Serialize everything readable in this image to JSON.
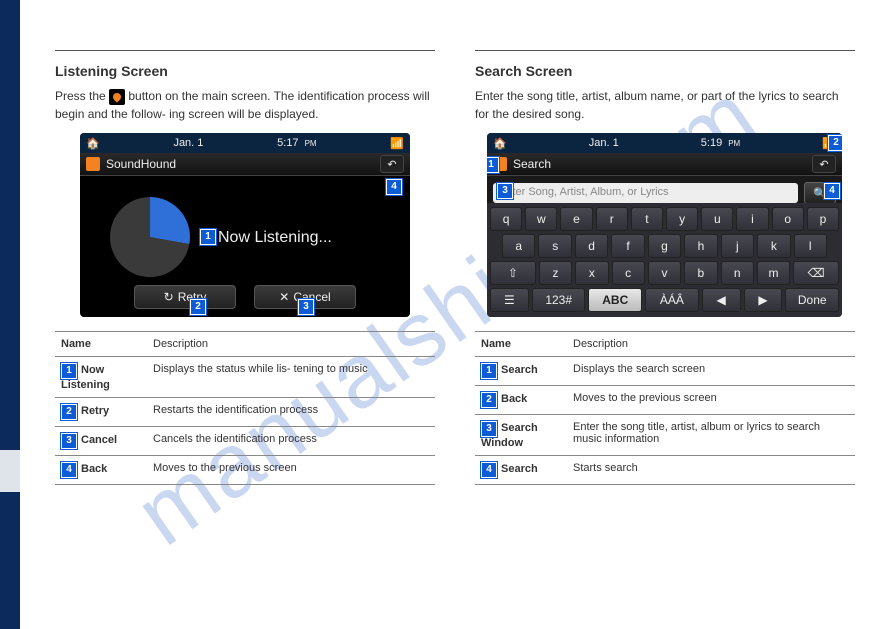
{
  "watermark": "manualshive.com",
  "sidebar": {},
  "left": {
    "title": "Listening Screen",
    "intro_before": "Press the ",
    "intro_after": " button on the main screen. The identification process will begin and the follow- ing screen will be displayed.",
    "shot": {
      "status_date": "Jan.   1",
      "status_time": "5:17",
      "status_ampm": "PM",
      "app_name": "SoundHound",
      "now_listening": "Now Listening...",
      "retry": "Retry",
      "cancel": "Cancel"
    },
    "table_header_name": "Name",
    "table_header_desc": "Description",
    "rows": [
      {
        "n": "1",
        "name": "Now Listening",
        "desc": "Displays the status while lis- tening to music"
      },
      {
        "n": "2",
        "name": "Retry",
        "desc": "Restarts the identification process"
      },
      {
        "n": "3",
        "name": "Cancel",
        "desc": "Cancels the identification process"
      },
      {
        "n": "4",
        "name": "Back",
        "desc": "Moves to the previous screen"
      }
    ]
  },
  "right": {
    "title": "Search Screen",
    "intro": "Enter the song title, artist, album name, or part of the lyrics to search for the desired song.",
    "shot": {
      "status_date": "Jan.   1",
      "status_time": "5:19",
      "status_ampm": "PM",
      "app_name": "Search",
      "placeholder": "Enter Song, Artist, Album, or Lyrics",
      "keys_row1": [
        "q",
        "w",
        "e",
        "r",
        "t",
        "y",
        "u",
        "i",
        "o",
        "p"
      ],
      "keys_row2": [
        "a",
        "s",
        "d",
        "f",
        "g",
        "h",
        "j",
        "k",
        "l"
      ],
      "keys_row3": [
        "⇧",
        "z",
        "x",
        "c",
        "v",
        "b",
        "n",
        "m",
        "⌫"
      ],
      "keys_row4": [
        "☰",
        "123#",
        "ABC",
        "ÀÁÂ",
        "◀",
        "▶",
        "Done"
      ]
    },
    "table_header_name": "Name",
    "table_header_desc": "Description",
    "rows": [
      {
        "n": "1",
        "name": "Search",
        "desc": "Displays the search screen"
      },
      {
        "n": "2",
        "name": "Back",
        "desc": "Moves to the previous screen"
      },
      {
        "n": "3",
        "name": "Search Window",
        "desc": "Enter the song title, artist, album or lyrics to search music information"
      },
      {
        "n": "4",
        "name": "Search",
        "desc": "Starts search"
      }
    ]
  }
}
